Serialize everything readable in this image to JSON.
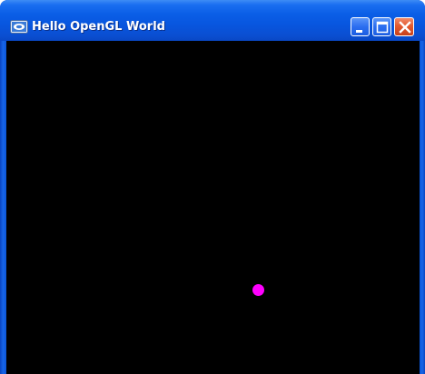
{
  "window": {
    "title": "Hello OpenGL World",
    "icon": "window-app-icon",
    "controls": {
      "minimize": "minimize-icon",
      "maximize": "maximize-icon",
      "close": "close-icon"
    }
  },
  "canvas": {
    "background": "#000000",
    "point_color": "#ff00ff"
  }
}
